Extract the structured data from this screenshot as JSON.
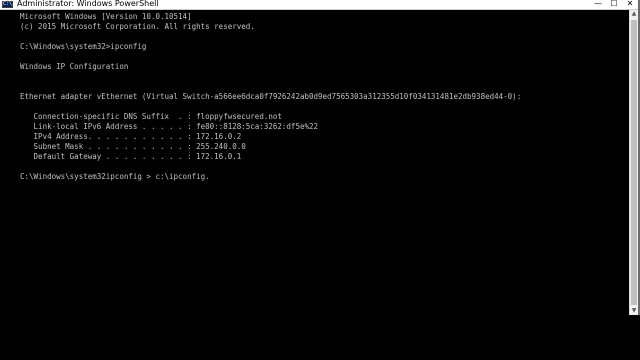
{
  "window": {
    "title": "Administrator: Windows PowerShell",
    "icon_label": "C:\\",
    "buttons": {
      "minimize": "—",
      "maximize": "☐",
      "close": "✕"
    }
  },
  "console": {
    "lines": [
      "Microsoft Windows [Version 10.0.10514]",
      "(c) 2015 Microsoft Corporation. All rights reserved.",
      "",
      "C:\\Windows\\system32>ipconfig",
      "",
      "Windows IP Configuration",
      "",
      "",
      "Ethernet adapter vEthernet (Virtual Switch-a566ee6dca0f7926242ab0d9ed7565303a312355d10f034131481e2db938ed44-0):",
      "",
      "   Connection-specific DNS Suffix  . : floppyfwsecured.not",
      "   Link-local IPv6 Address . . . . . : fe80::8128:5ca:3262:df5e%22",
      "   IPv4 Address. . . . . . . . . . . : 172.16.0.2",
      "   Subnet Mask . . . . . . . . . . . : 255.240.0.0",
      "   Default Gateway . . . . . . . . . : 172.16.0.1",
      "",
      "C:\\Windows\\system32ipconfig > c:\\ipconfig."
    ]
  },
  "scrollbar": {
    "up_arrow": "▲",
    "down_arrow": "▼"
  }
}
